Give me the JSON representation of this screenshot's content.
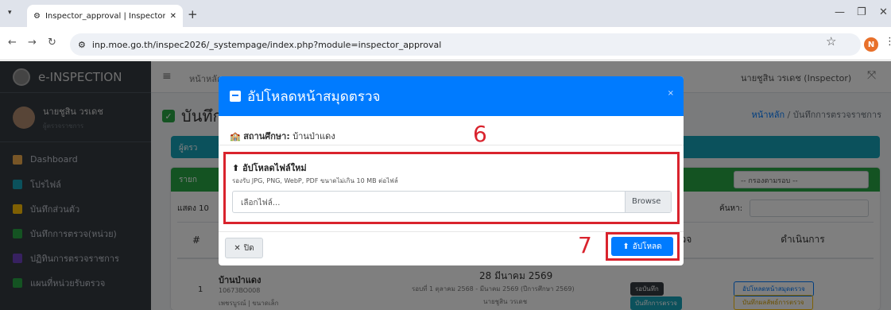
{
  "browser": {
    "tab_title": "Inspector_approval | Inspector",
    "new_tab": "+",
    "url": "inp.moe.go.th/inspec2026/_systempage/index.php?module=inspector_approval",
    "profile_initial": "N"
  },
  "app": {
    "brand": "e-INSPECTION",
    "user_name": "นายชูสิน วรเดช",
    "user_role": "ผู้ตรวจราชการ",
    "menu": [
      {
        "label": "Dashboard",
        "color": "#f0ad4e"
      },
      {
        "label": "โปรไฟล์",
        "color": "#17a2b8"
      },
      {
        "label": "บันทึกส่วนตัว",
        "color": "#ffc107"
      },
      {
        "label": "บันทึกการตรวจ(หน่วย)",
        "color": "#28a745"
      },
      {
        "label": "ปฏิทินการตรวจราชการ",
        "color": "#6f42c1"
      },
      {
        "label": "แผนที่หน่วยรับตรวจ",
        "color": "#28a745"
      }
    ],
    "topnav_home": "หน้าหลัก",
    "topnav_user": "นายชูสิน วรเดช (Inspector)",
    "page_title": "บันทึก",
    "breadcrumb_home": "หน้าหลัก",
    "breadcrumb_current": "บันทึกการตรวจราชการ",
    "inspector_card": "ผู้ตรว",
    "list_header": "รายก",
    "filter_placeholder": "-- กรองตามรอบ --",
    "show_label": "แสดง 10",
    "search_label": "ค้นหา:",
    "columns": [
      "#",
      "การตรวจ",
      "ดำเนินการ"
    ],
    "row": {
      "num": "1",
      "school": "บ้านป่าแดง",
      "code": "10673BO008",
      "location": "เพชรบูรณ์ | ขนาดเล็ก",
      "date": "28 มีนาคม 2569",
      "round": "รอบที่ 1 ตุลาคม 2568 - มีนาคม 2569 (ปีการศึกษา 2569)",
      "inspector": "นายชูสิน วรเดช",
      "badge1": "รอบันทึก",
      "badge2": "บันทึกการตรวจ",
      "action1": "อัปโหลดหน้าสมุดตรวจ",
      "action2": "บันทึกผลลัพธ์การตรวจ"
    }
  },
  "modal": {
    "title": "อัปโหลดหน้าสมุดตรวจ",
    "close_x": "×",
    "school_label": "สถานศึกษา:",
    "school_name": "บ้านป่าแดง",
    "step6": "6",
    "upload_title": "อัปโหลดไฟล์ใหม่",
    "upload_hint": "รองรับ JPG, PNG, WebP, PDF ขนาดไม่เกิน 10 MB ต่อไฟล์",
    "file_placeholder": "เลือกไฟล์...",
    "browse": "Browse",
    "close_button": "ปิด",
    "step7": "7",
    "upload_button": "อัปโหลด"
  }
}
